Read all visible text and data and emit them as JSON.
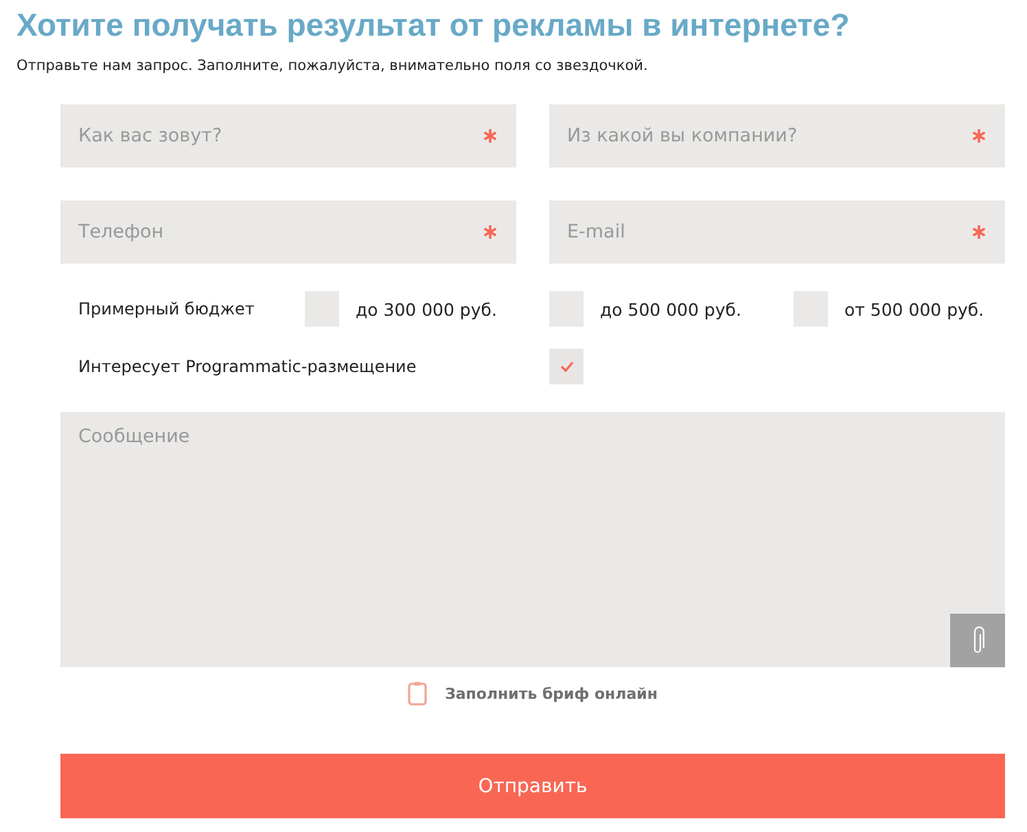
{
  "heading": {
    "title": "Хотите получать результат от рекламы в интернете?",
    "subtitle": "Отправьте нам запрос. Заполните, пожалуйста, внимательно поля со звездочкой."
  },
  "fields": [
    {
      "placeholder": "Как вас зовут?",
      "required": true
    },
    {
      "placeholder": "Из какой вы компании?",
      "required": true
    },
    {
      "placeholder": "Телефон",
      "required": true
    },
    {
      "placeholder": "E-mail",
      "required": true
    }
  ],
  "budget": {
    "label": "Примерный бюджет",
    "options": [
      {
        "label": "до 300 000 руб.",
        "selected": false
      },
      {
        "label": "до 500 000 руб.",
        "selected": false
      },
      {
        "label": "от 500 000 руб.",
        "selected": false
      }
    ]
  },
  "programmatic": {
    "label": "Интересует Programmatic-размещение",
    "checked": true
  },
  "message": {
    "placeholder": "Сообщение"
  },
  "brief_link": {
    "label": "Заполнить бриф онлайн"
  },
  "submit": {
    "label": "Отправить"
  }
}
